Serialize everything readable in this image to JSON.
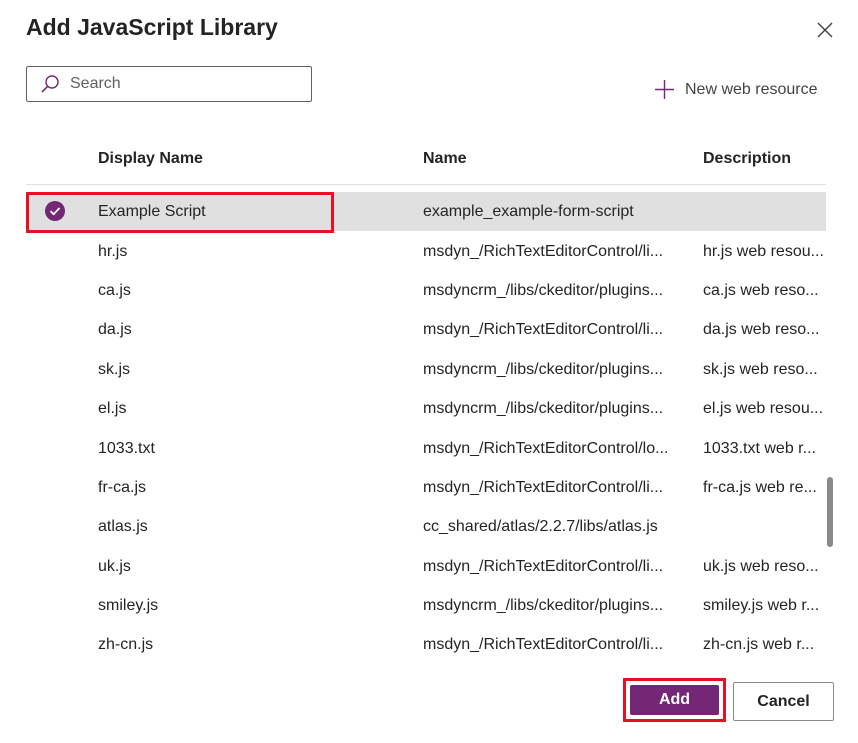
{
  "dialog": {
    "title": "Add JavaScript Library"
  },
  "search": {
    "placeholder": "Search",
    "value": ""
  },
  "new_resource": {
    "label": "New web resource"
  },
  "columns": {
    "display_name": "Display Name",
    "name": "Name",
    "description": "Description"
  },
  "rows": [
    {
      "display_name": "Example Script",
      "name": "example_example-form-script",
      "description": "",
      "selected": true
    },
    {
      "display_name": "hr.js",
      "name": "msdyn_/RichTextEditorControl/li...",
      "description": "hr.js web resou..."
    },
    {
      "display_name": "ca.js",
      "name": "msdyncrm_/libs/ckeditor/plugins...",
      "description": "ca.js web reso..."
    },
    {
      "display_name": "da.js",
      "name": "msdyn_/RichTextEditorControl/li...",
      "description": "da.js web reso..."
    },
    {
      "display_name": "sk.js",
      "name": "msdyncrm_/libs/ckeditor/plugins...",
      "description": "sk.js web reso..."
    },
    {
      "display_name": "el.js",
      "name": "msdyncrm_/libs/ckeditor/plugins...",
      "description": "el.js web resou..."
    },
    {
      "display_name": "1033.txt",
      "name": "msdyn_/RichTextEditorControl/lo...",
      "description": "1033.txt web r..."
    },
    {
      "display_name": "fr-ca.js",
      "name": "msdyn_/RichTextEditorControl/li...",
      "description": "fr-ca.js web re..."
    },
    {
      "display_name": "atlas.js",
      "name": "cc_shared/atlas/2.2.7/libs/atlas.js",
      "description": ""
    },
    {
      "display_name": "uk.js",
      "name": "msdyn_/RichTextEditorControl/li...",
      "description": "uk.js web reso..."
    },
    {
      "display_name": "smiley.js",
      "name": "msdyncrm_/libs/ckeditor/plugins...",
      "description": "smiley.js web r..."
    },
    {
      "display_name": "zh-cn.js",
      "name": "msdyn_/RichTextEditorControl/li...",
      "description": "zh-cn.js web r..."
    }
  ],
  "buttons": {
    "add": "Add",
    "cancel": "Cancel"
  },
  "icons": {
    "close": "close-icon",
    "search": "search-icon",
    "add": "plus-icon",
    "check": "checkmark-circle-icon"
  },
  "colors": {
    "accent": "#742774",
    "highlight": "#e81123",
    "selected_row": "#e0e0e0"
  }
}
